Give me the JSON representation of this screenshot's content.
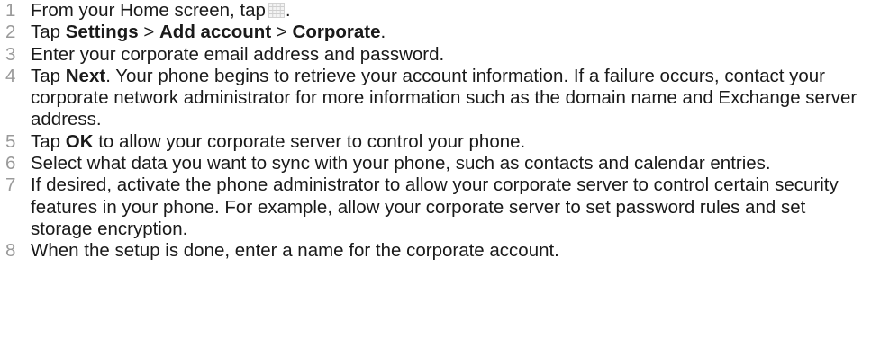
{
  "steps": [
    {
      "number": "1",
      "before_icon": "From your Home screen, tap",
      "icon": "apps-grid-icon",
      "after_icon": "."
    },
    {
      "number": "2",
      "t1": "Tap ",
      "b1": "Settings",
      "t2": " > ",
      "b2": "Add account",
      "t3": " > ",
      "b3": "Corporate",
      "t4": "."
    },
    {
      "number": "3",
      "text": "Enter your corporate email address and password."
    },
    {
      "number": "4",
      "t1": "Tap ",
      "b1": "Next",
      "t2": ". Your phone begins to retrieve your account information. If a failure occurs, contact your corporate network administrator for more information such as the domain name and Exchange server address."
    },
    {
      "number": "5",
      "t1": "Tap ",
      "b1": "OK",
      "t2": " to allow your corporate server to control your phone."
    },
    {
      "number": "6",
      "text": "Select what data you want to sync with your phone, such as contacts and calendar entries."
    },
    {
      "number": "7",
      "text": "If desired, activate the phone administrator to allow your corporate server to control certain security features in your phone. For example, allow your corporate server to set password rules and set storage encryption."
    },
    {
      "number": "8",
      "text": "When the setup is done, enter a name for the corporate account."
    }
  ],
  "colors": {
    "text": "#1a1a1a",
    "step_number": "#9a9a9a",
    "icon_grid": "#c9c9c9"
  }
}
